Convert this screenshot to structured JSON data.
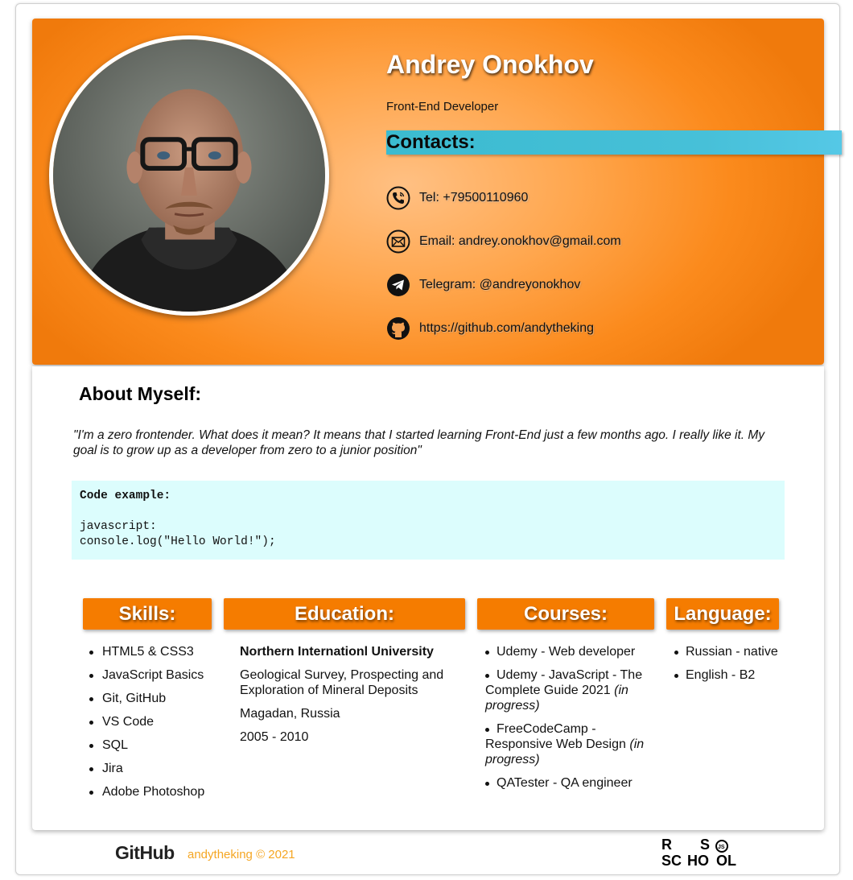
{
  "profile": {
    "name": "Andrey Onokhov",
    "position": "Front-End Developer"
  },
  "contacts": {
    "title": "Contacts:",
    "items": [
      {
        "icon": "phone-icon",
        "text": "Tel: +79500110960"
      },
      {
        "icon": "email-icon",
        "text": "Email: andrey.onokhov@gmail.com"
      },
      {
        "icon": "telegram-icon",
        "text": "Telegram: @andreyonokhov"
      },
      {
        "icon": "github-icon",
        "text": "https://github.com/andytheking"
      }
    ]
  },
  "about": {
    "title": "About Myself:",
    "text": "\"I'm a zero frontender. What does it mean? It means that I started learning Front-End just a few months ago. I really like it. My goal is to grow up as a developer from zero to a junior position\""
  },
  "code": {
    "heading": "Code example:",
    "line1": "javascript:",
    "line2": "console.log(\"Hello World!\");"
  },
  "skills": {
    "title": "Skills:",
    "items": [
      "HTML5 & CSS3",
      "JavaScript Basics",
      "Git, GitHub",
      "VS Code",
      "SQL",
      "Jira",
      "Adobe Photoshop"
    ]
  },
  "education": {
    "title": "Education:",
    "university": "Northern Internationl University",
    "faculty": "Geological Survey, Prospecting and Exploration of Mineral Deposits",
    "location": "Magadan, Russia",
    "years": "2005 - 2010"
  },
  "courses": {
    "title": "Courses:",
    "items": [
      {
        "text": "Udemy - Web developer",
        "note": ""
      },
      {
        "text": "Udemy - JavaScript - The Complete Guide 2021 ",
        "note": "(in progress)"
      },
      {
        "text": "FreeCodeCamp - Responsive Web Design ",
        "note": "(in progress)"
      },
      {
        "text": "QATester - QA engineer",
        "note": ""
      }
    ]
  },
  "language": {
    "title": "Language:",
    "items": [
      "Russian - native",
      "English - B2"
    ]
  },
  "footer": {
    "github_logo": "GitHub",
    "copyright": "andytheking © 2021",
    "school_logo": "RS SCHOOL"
  },
  "colors": {
    "accent": "#f57c00",
    "contacts_bar": "#47c0d8",
    "code_bg": "#dcfdfd",
    "footer_text": "#f5a623"
  }
}
